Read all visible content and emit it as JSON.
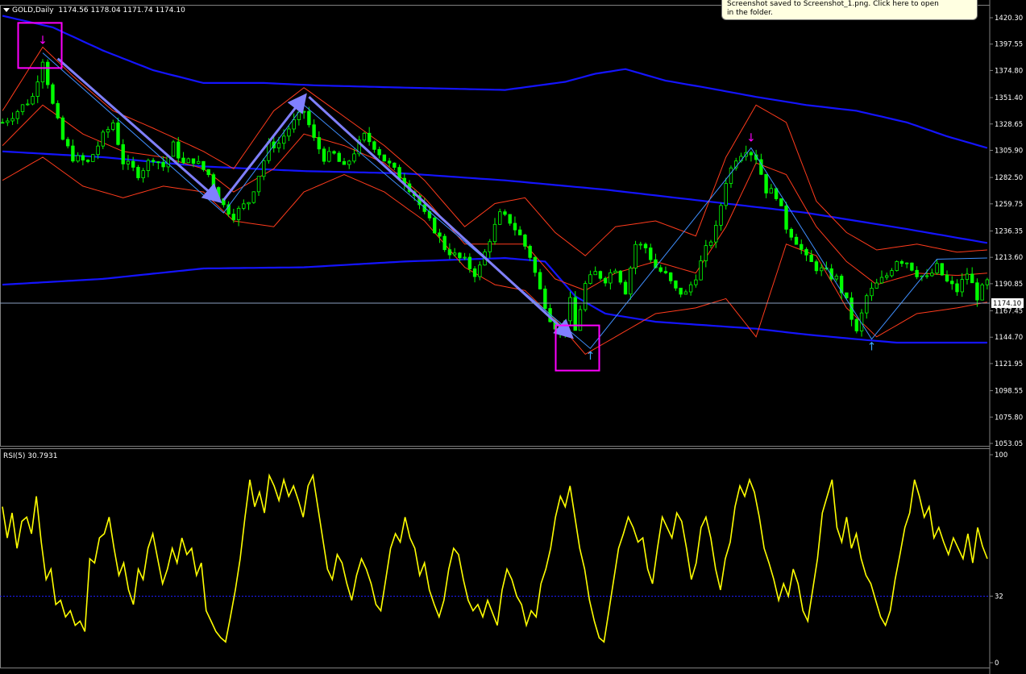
{
  "header": {
    "symbol": "GOLD,Daily",
    "ohlc": "1174.56 1178.04 1171.74 1174.10"
  },
  "rsi_header": {
    "label": "RSI(5) 30.7931"
  },
  "tooltip": {
    "line1": "Screenshot saved to Screenshot_1.png. Click here to open",
    "line2": "in the folder."
  },
  "colors": {
    "background": "#000000",
    "candle_up": "#00ff00",
    "candle_down": "#00ff00",
    "bollinger_short": "#ff3b1c",
    "bollinger_long": "#1414ff",
    "zigzag": "#3f8fff",
    "arrow": "#8080ff",
    "highlight_box": "#ff00ff",
    "rsi_line": "#ffff00",
    "current_price_line": "#8aa0c0"
  },
  "chart_data": [
    {
      "type": "candlestick",
      "title": "GOLD,Daily",
      "y_ticks": [
        "1420.30",
        "1397.55",
        "1374.80",
        "1351.40",
        "1328.65",
        "1305.90",
        "1282.50",
        "1259.75",
        "1236.35",
        "1213.60",
        "1190.85",
        "1167.45",
        "1144.70",
        "1121.95",
        "1098.55",
        "1075.80",
        "1053.05"
      ],
      "ylim": [
        1053.05,
        1420.3
      ],
      "current_price": "1174.10",
      "close_path": [
        [
          0,
          1330
        ],
        [
          3,
          1340
        ],
        [
          6,
          1352
        ],
        [
          8,
          1385
        ],
        [
          10,
          1345
        ],
        [
          12,
          1315
        ],
        [
          14,
          1300
        ],
        [
          17,
          1295
        ],
        [
          20,
          1318
        ],
        [
          22,
          1330
        ],
        [
          24,
          1296
        ],
        [
          27,
          1286
        ],
        [
          30,
          1300
        ],
        [
          32,
          1292
        ],
        [
          34,
          1310
        ],
        [
          36,
          1294
        ],
        [
          38,
          1298
        ],
        [
          41,
          1285
        ],
        [
          44,
          1258
        ],
        [
          46,
          1250
        ],
        [
          49,
          1262
        ],
        [
          51,
          1285
        ],
        [
          53,
          1310
        ],
        [
          55,
          1312
        ],
        [
          57,
          1325
        ],
        [
          60,
          1340
        ],
        [
          62,
          1315
        ],
        [
          64,
          1300
        ],
        [
          66,
          1302
        ],
        [
          68,
          1290
        ],
        [
          70,
          1305
        ],
        [
          72,
          1318
        ],
        [
          74,
          1310
        ],
        [
          76,
          1298
        ],
        [
          78,
          1288
        ],
        [
          80,
          1280
        ],
        [
          82,
          1268
        ],
        [
          84,
          1250
        ],
        [
          86,
          1238
        ],
        [
          88,
          1222
        ],
        [
          90,
          1215
        ],
        [
          92,
          1210
        ],
        [
          94,
          1200
        ],
        [
          95,
          1205
        ],
        [
          97,
          1230
        ],
        [
          99,
          1250
        ],
        [
          101,
          1245
        ],
        [
          103,
          1232
        ],
        [
          105,
          1215
        ],
        [
          107,
          1185
        ],
        [
          109,
          1162
        ],
        [
          111,
          1148
        ],
        [
          113,
          1175
        ],
        [
          114,
          1150
        ],
        [
          116,
          1190
        ],
        [
          118,
          1200
        ],
        [
          120,
          1195
        ],
        [
          122,
          1205
        ],
        [
          124,
          1185
        ],
        [
          126,
          1225
        ],
        [
          128,
          1222
        ],
        [
          130,
          1205
        ],
        [
          132,
          1198
        ],
        [
          134,
          1185
        ],
        [
          136,
          1182
        ],
        [
          138,
          1198
        ],
        [
          140,
          1220
        ],
        [
          142,
          1238
        ],
        [
          144,
          1280
        ],
        [
          146,
          1300
        ],
        [
          148,
          1308
        ],
        [
          150,
          1300
        ],
        [
          152,
          1272
        ],
        [
          154,
          1268
        ],
        [
          156,
          1240
        ],
        [
          158,
          1228
        ],
        [
          160,
          1212
        ],
        [
          162,
          1205
        ],
        [
          164,
          1200
        ],
        [
          166,
          1195
        ],
        [
          168,
          1175
        ],
        [
          170,
          1148
        ],
        [
          172,
          1180
        ],
        [
          174,
          1190
        ],
        [
          176,
          1198
        ],
        [
          178,
          1212
        ],
        [
          180,
          1210
        ],
        [
          182,
          1200
        ],
        [
          184,
          1195
        ],
        [
          186,
          1205
        ],
        [
          188,
          1192
        ],
        [
          190,
          1185
        ],
        [
          192,
          1200
        ],
        [
          194,
          1180
        ],
        [
          196,
          1192
        ]
      ],
      "bollinger_short": {
        "upper": [
          [
            0,
            1340
          ],
          [
            8,
            1395
          ],
          [
            14,
            1370
          ],
          [
            22,
            1340
          ],
          [
            30,
            1325
          ],
          [
            40,
            1305
          ],
          [
            46,
            1290
          ],
          [
            54,
            1340
          ],
          [
            60,
            1360
          ],
          [
            68,
            1335
          ],
          [
            76,
            1310
          ],
          [
            84,
            1280
          ],
          [
            92,
            1240
          ],
          [
            98,
            1260
          ],
          [
            104,
            1265
          ],
          [
            110,
            1235
          ],
          [
            116,
            1215
          ],
          [
            122,
            1240
          ],
          [
            130,
            1245
          ],
          [
            138,
            1232
          ],
          [
            144,
            1300
          ],
          [
            150,
            1345
          ],
          [
            156,
            1330
          ],
          [
            162,
            1262
          ],
          [
            168,
            1235
          ],
          [
            174,
            1220
          ],
          [
            182,
            1225
          ],
          [
            190,
            1218
          ],
          [
            196,
            1220
          ]
        ],
        "middle": [
          [
            0,
            1310
          ],
          [
            8,
            1345
          ],
          [
            16,
            1320
          ],
          [
            24,
            1305
          ],
          [
            32,
            1300
          ],
          [
            40,
            1290
          ],
          [
            46,
            1270
          ],
          [
            54,
            1290
          ],
          [
            60,
            1320
          ],
          [
            68,
            1310
          ],
          [
            76,
            1295
          ],
          [
            84,
            1265
          ],
          [
            92,
            1225
          ],
          [
            98,
            1225
          ],
          [
            104,
            1225
          ],
          [
            110,
            1195
          ],
          [
            116,
            1185
          ],
          [
            122,
            1200
          ],
          [
            130,
            1210
          ],
          [
            138,
            1200
          ],
          [
            144,
            1240
          ],
          [
            150,
            1295
          ],
          [
            156,
            1285
          ],
          [
            162,
            1240
          ],
          [
            168,
            1210
          ],
          [
            174,
            1190
          ],
          [
            182,
            1200
          ],
          [
            190,
            1198
          ],
          [
            196,
            1200
          ]
        ],
        "lower": [
          [
            0,
            1280
          ],
          [
            8,
            1300
          ],
          [
            16,
            1275
          ],
          [
            24,
            1265
          ],
          [
            32,
            1275
          ],
          [
            40,
            1270
          ],
          [
            46,
            1245
          ],
          [
            54,
            1240
          ],
          [
            60,
            1270
          ],
          [
            68,
            1285
          ],
          [
            76,
            1270
          ],
          [
            84,
            1245
          ],
          [
            92,
            1205
          ],
          [
            98,
            1190
          ],
          [
            104,
            1185
          ],
          [
            110,
            1160
          ],
          [
            116,
            1130
          ],
          [
            122,
            1145
          ],
          [
            130,
            1165
          ],
          [
            138,
            1170
          ],
          [
            144,
            1178
          ],
          [
            150,
            1145
          ],
          [
            156,
            1225
          ],
          [
            162,
            1215
          ],
          [
            168,
            1170
          ],
          [
            174,
            1145
          ],
          [
            182,
            1165
          ],
          [
            190,
            1170
          ],
          [
            196,
            1175
          ]
        ]
      },
      "bollinger_long": {
        "upper": [
          [
            0,
            1422
          ],
          [
            10,
            1412
          ],
          [
            20,
            1392
          ],
          [
            30,
            1375
          ],
          [
            40,
            1364
          ],
          [
            52,
            1364
          ],
          [
            62,
            1362
          ],
          [
            80,
            1360
          ],
          [
            100,
            1358
          ],
          [
            112,
            1365
          ],
          [
            118,
            1372
          ],
          [
            124,
            1376
          ],
          [
            132,
            1366
          ],
          [
            140,
            1360
          ],
          [
            150,
            1352
          ],
          [
            160,
            1345
          ],
          [
            170,
            1340
          ],
          [
            180,
            1330
          ],
          [
            188,
            1318
          ],
          [
            196,
            1308
          ]
        ],
        "middle": [
          [
            0,
            1305
          ],
          [
            20,
            1300
          ],
          [
            40,
            1292
          ],
          [
            60,
            1288
          ],
          [
            80,
            1286
          ],
          [
            100,
            1280
          ],
          [
            120,
            1272
          ],
          [
            140,
            1262
          ],
          [
            160,
            1252
          ],
          [
            180,
            1238
          ],
          [
            196,
            1226
          ]
        ],
        "lower": [
          [
            0,
            1190
          ],
          [
            20,
            1195
          ],
          [
            40,
            1204
          ],
          [
            60,
            1205
          ],
          [
            80,
            1210
          ],
          [
            100,
            1213
          ],
          [
            108,
            1210
          ],
          [
            114,
            1180
          ],
          [
            120,
            1165
          ],
          [
            130,
            1158
          ],
          [
            140,
            1155
          ],
          [
            150,
            1152
          ],
          [
            160,
            1147
          ],
          [
            170,
            1143
          ],
          [
            178,
            1140
          ],
          [
            186,
            1140
          ],
          [
            196,
            1140
          ]
        ]
      },
      "zigzag": [
        [
          8,
          1390
        ],
        [
          44,
          1252
        ],
        [
          60,
          1345
        ],
        [
          117,
          1135
        ],
        [
          149,
          1308
        ],
        [
          173,
          1143
        ],
        [
          186,
          1212
        ],
        [
          196,
          1213
        ]
      ],
      "arrows": [
        [
          11,
          1385,
          43,
          1263
        ],
        [
          44,
          1263,
          60,
          1352
        ],
        [
          61,
          1352,
          113,
          1146
        ]
      ],
      "highlight_boxes": [
        [
          6,
          1395
        ],
        [
          113,
          1134
        ]
      ],
      "markers": {
        "down": [
          [
            8,
            1392
          ],
          [
            149,
            1308
          ]
        ],
        "up": [
          [
            117,
            1135
          ],
          [
            173,
            1143
          ]
        ]
      }
    },
    {
      "type": "line",
      "title": "RSI(5) 30.7931",
      "y_ticks": [
        "100",
        "32",
        "0"
      ],
      "ylim": [
        0,
        100
      ],
      "level": 32,
      "values": [
        75,
        60,
        72,
        55,
        68,
        70,
        62,
        80,
        58,
        40,
        45,
        28,
        30,
        22,
        25,
        18,
        20,
        15,
        50,
        48,
        60,
        62,
        70,
        55,
        42,
        48,
        35,
        28,
        45,
        40,
        55,
        62,
        50,
        38,
        45,
        55,
        48,
        60,
        52,
        55,
        42,
        48,
        25,
        20,
        15,
        12,
        10,
        22,
        35,
        50,
        70,
        88,
        75,
        82,
        72,
        90,
        85,
        78,
        88,
        80,
        85,
        78,
        70,
        85,
        90,
        75,
        60,
        45,
        40,
        52,
        48,
        38,
        30,
        42,
        50,
        45,
        38,
        28,
        25,
        40,
        55,
        62,
        58,
        70,
        60,
        55,
        42,
        48,
        35,
        28,
        22,
        30,
        45,
        55,
        52,
        40,
        30,
        25,
        28,
        22,
        30,
        24,
        18,
        35,
        45,
        40,
        32,
        28,
        18,
        25,
        22,
        38,
        45,
        55,
        70,
        80,
        75,
        85,
        70,
        55,
        45,
        30,
        20,
        12,
        10,
        25,
        40,
        55,
        62,
        70,
        65,
        58,
        60,
        45,
        38,
        55,
        70,
        65,
        60,
        72,
        68,
        55,
        40,
        48,
        65,
        70,
        60,
        45,
        35,
        50,
        58,
        75,
        85,
        80,
        88,
        82,
        70,
        55,
        48,
        40,
        30,
        38,
        32,
        45,
        38,
        25,
        20,
        35,
        50,
        72,
        80,
        88,
        65,
        58,
        70,
        55,
        62,
        50,
        42,
        38,
        30,
        22,
        18,
        25,
        40,
        52,
        65,
        72,
        88,
        80,
        70,
        75,
        60,
        65,
        58,
        52,
        60,
        55,
        50,
        62,
        48,
        65,
        56,
        50
      ]
    }
  ]
}
